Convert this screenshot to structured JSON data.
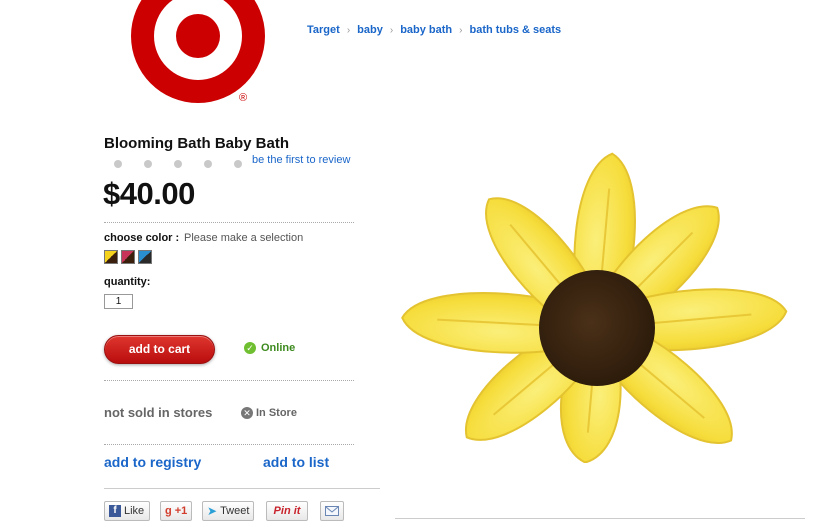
{
  "brand": {
    "logo_icon": "target-bullseye-logo",
    "logo_color": "#cc0000",
    "registered_mark": "®"
  },
  "breadcrumb": [
    {
      "label": "Target"
    },
    {
      "label": "baby"
    },
    {
      "label": "baby bath"
    },
    {
      "label": "bath tubs & seats"
    }
  ],
  "product": {
    "title": "Blooming Bath Baby Bath",
    "rating_dots": 5,
    "review_link": "be the first to review",
    "price": "$40.00",
    "choose_color_label": "choose color :",
    "color_hint": "Please make a selection",
    "swatches": [
      {
        "color": "#f5d21c",
        "accent": "#3a1f0c"
      },
      {
        "color": "#c8335a",
        "accent": "#3a1f0c"
      },
      {
        "color": "#2a8fd0",
        "accent": "#2a2a2a"
      }
    ],
    "quantity_label": "quantity:",
    "quantity_value": "1",
    "add_to_cart": "add to cart",
    "online_status": "Online",
    "not_sold_in_stores": "not sold in stores",
    "in_store": "In Store",
    "add_to_registry": "add to registry",
    "add_to_list": "add to list"
  },
  "share": {
    "facebook": "Like",
    "google": "+1",
    "twitter": "Tweet",
    "pinterest": "Pin it",
    "email_icon": "envelope-icon"
  },
  "colors": {
    "link": "#1a66c9",
    "cart_button": "#cc1a1a",
    "online_green": "#3d8a1f",
    "petal": "#f7e24a",
    "center": "#3b2510"
  }
}
